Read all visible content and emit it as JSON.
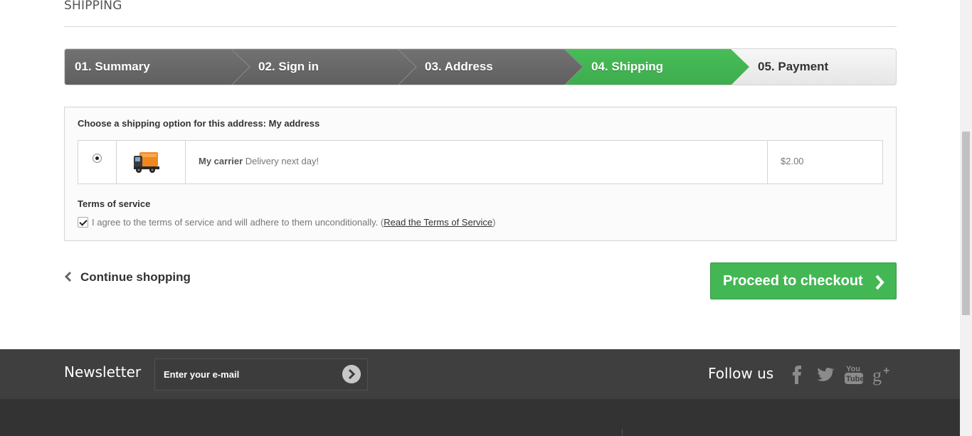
{
  "page": {
    "heading": "SHIPPING"
  },
  "steps": [
    {
      "label": "01. Summary",
      "state": "done"
    },
    {
      "label": "02. Sign in",
      "state": "done"
    },
    {
      "label": "03. Address",
      "state": "done"
    },
    {
      "label": "04. Shipping",
      "state": "current"
    },
    {
      "label": "05. Payment",
      "state": "todo"
    }
  ],
  "colors": {
    "step_done": "#6b6b6b",
    "step_current": "#43b754",
    "accent_green": "#43b754",
    "footer_dark": "#3f3f3f"
  },
  "shipping": {
    "title": "Choose a shipping option for this address: My address",
    "carrier": {
      "selected": true,
      "name": "My carrier",
      "delay": "Delivery next day!",
      "price": "$2.00",
      "icon": "truck-icon"
    },
    "tos_title": "Terms of service",
    "tos_checked": true,
    "tos_text": "I agree to the terms of service and will adhere to them unconditionally.",
    "tos_link_open": " (",
    "tos_link": "Read the Terms of Service",
    "tos_link_close": ")"
  },
  "navigation": {
    "continue_label": "Continue shopping",
    "checkout_label": "Proceed to checkout"
  },
  "footer": {
    "newsletter_title": "Newsletter",
    "newsletter_placeholder": "Enter your e-mail",
    "follow_title": "Follow us",
    "social": [
      "facebook-icon",
      "twitter-icon",
      "youtube-icon",
      "google-plus-icon"
    ]
  }
}
